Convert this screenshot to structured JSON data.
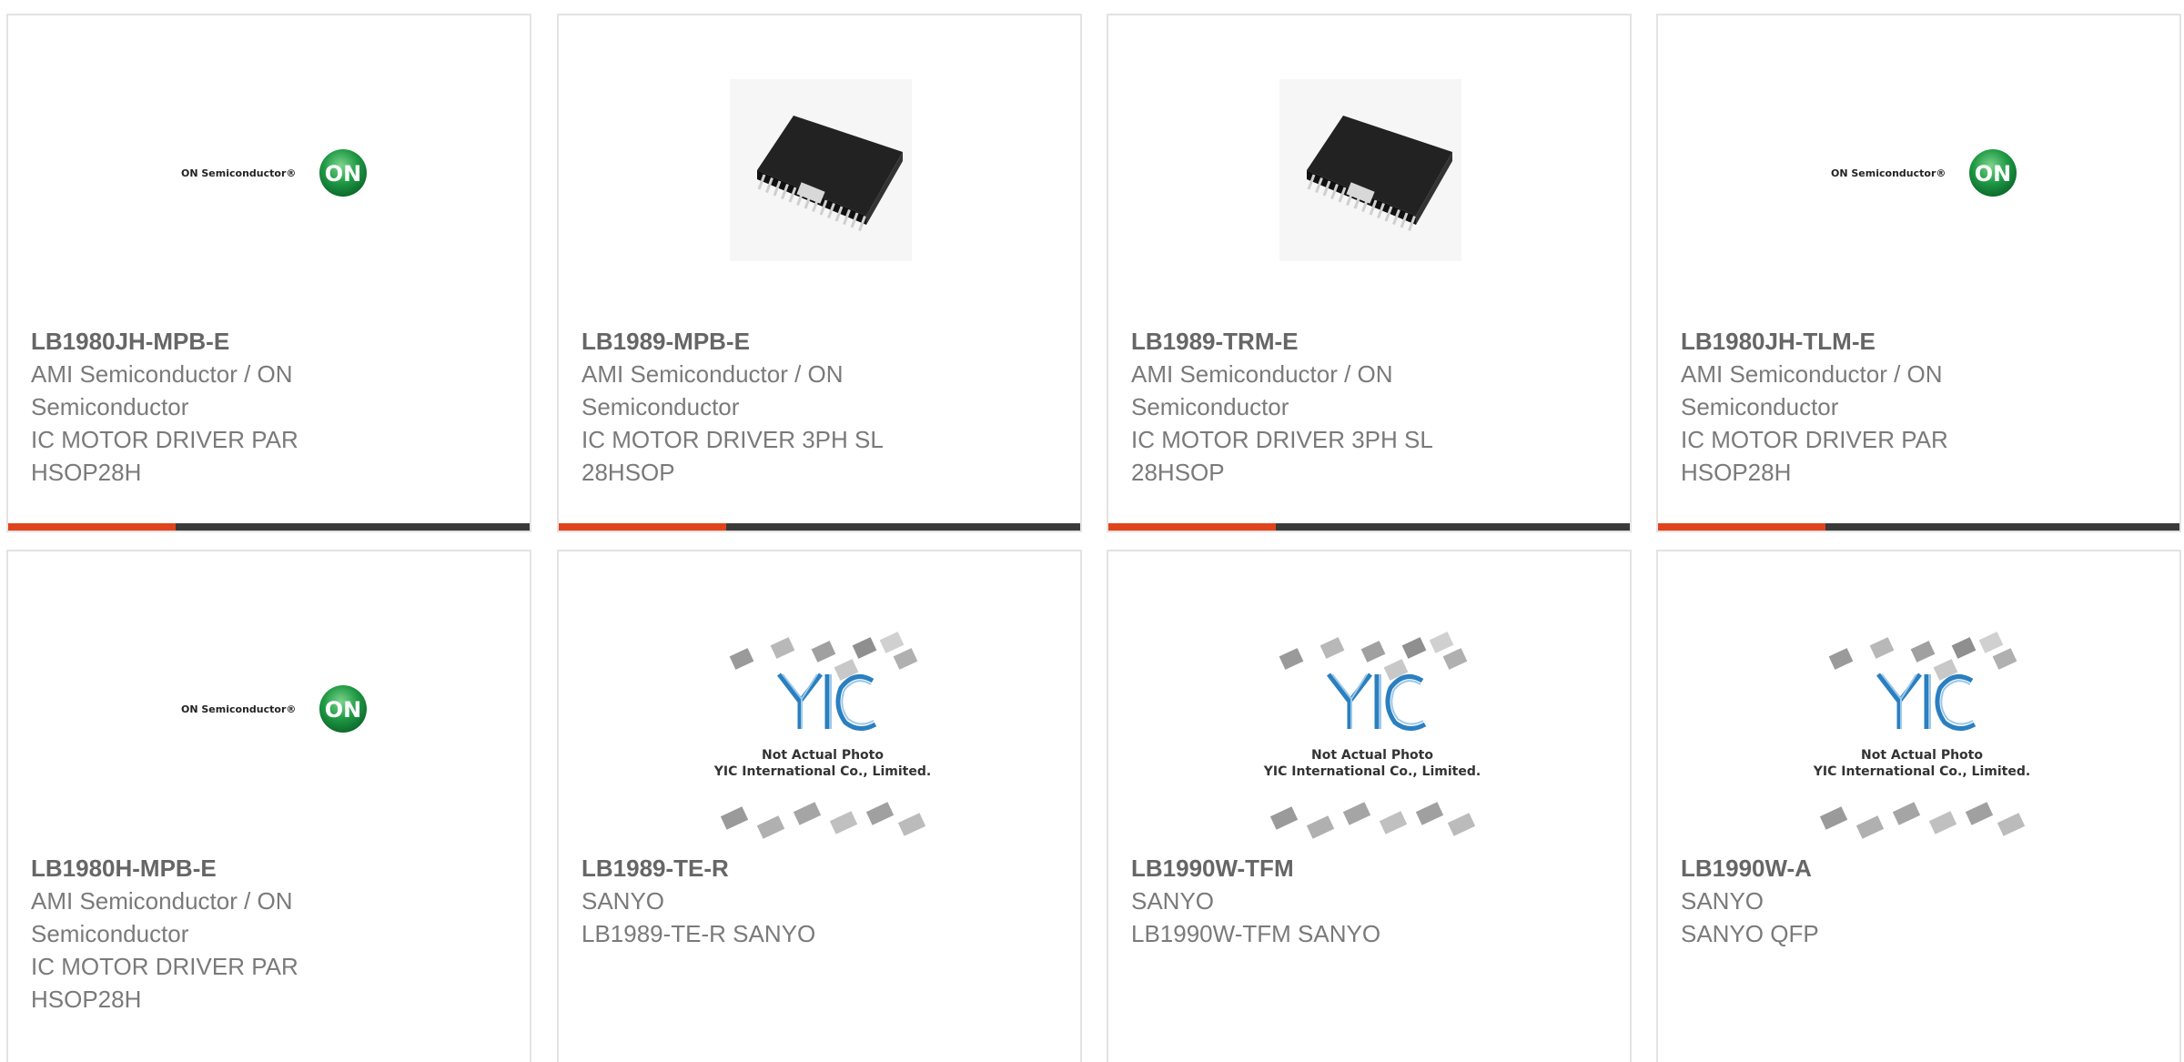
{
  "products": [
    {
      "part_number": "LB1980JH-MPB-E",
      "manufacturer": "AMI Semiconductor / ON Semiconductor",
      "description": "IC MOTOR DRIVER PAR HSOP28H",
      "image": "on-semiconductor-logo"
    },
    {
      "part_number": "LB1989-MPB-E",
      "manufacturer": "AMI Semiconductor / ON Semiconductor",
      "description": "IC MOTOR DRIVER 3PH SL 28HSOP",
      "image": "chip-photo"
    },
    {
      "part_number": "LB1989-TRM-E",
      "manufacturer": "AMI Semiconductor / ON Semiconductor",
      "description": "IC MOTOR DRIVER 3PH SL 28HSOP",
      "image": "chip-photo"
    },
    {
      "part_number": "LB1980JH-TLM-E",
      "manufacturer": "AMI Semiconductor / ON Semiconductor",
      "description": "IC MOTOR DRIVER PAR HSOP28H",
      "image": "on-semiconductor-logo"
    },
    {
      "part_number": "LB1980H-MPB-E",
      "manufacturer": "AMI Semiconductor / ON Semiconductor",
      "description": "IC MOTOR DRIVER PAR HSOP28H",
      "image": "on-semiconductor-logo"
    },
    {
      "part_number": "LB1989-TE-R",
      "manufacturer": "SANYO",
      "description": "LB1989-TE-R SANYO",
      "image": "yic-placeholder"
    },
    {
      "part_number": "LB1990W-TFM",
      "manufacturer": "SANYO",
      "description": "LB1990W-TFM SANYO",
      "image": "yic-placeholder"
    },
    {
      "part_number": "LB1990W-A",
      "manufacturer": "SANYO",
      "description": "SANYO QFP",
      "image": "yic-placeholder"
    }
  ],
  "logo_text": {
    "on_semiconductor": "ON Semiconductor®",
    "on_badge": "ON"
  },
  "placeholder": {
    "brand": "YIC",
    "line1": "Not Actual Photo",
    "line2": "YIC International Co., Limited."
  },
  "colors": {
    "accent": "#e0441c",
    "bar": "#3a3a3a",
    "border": "#e3e3e3",
    "text": "#777777",
    "on_green": "#1f9a45",
    "yic_blue": "#2a7fc0"
  }
}
